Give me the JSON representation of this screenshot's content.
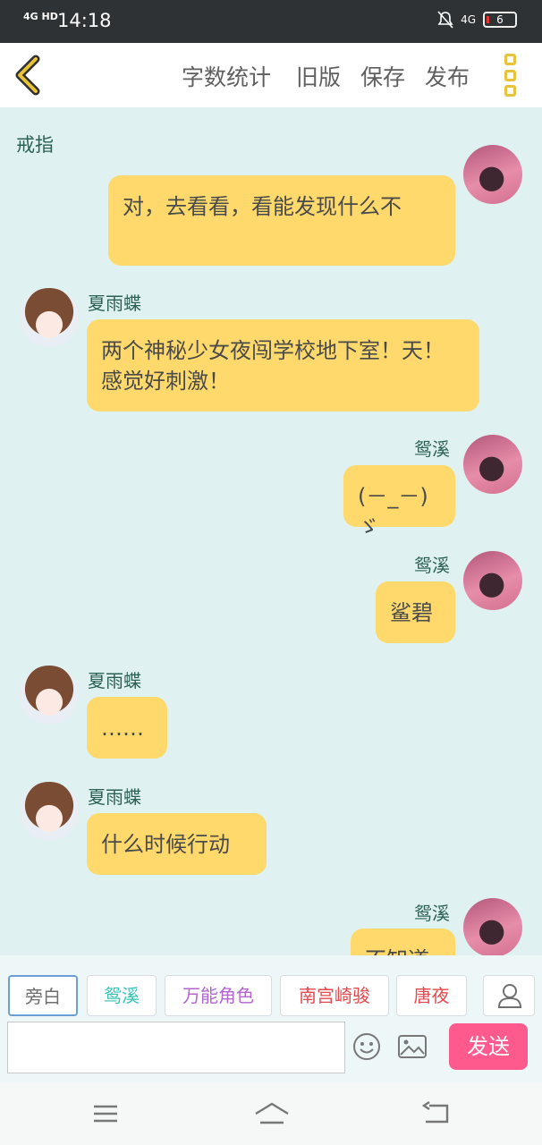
{
  "status_bar": {
    "signal": "4G HD",
    "time": "14:18",
    "network": "4G",
    "battery": "6"
  },
  "header": {
    "buttons": [
      "字数统计",
      "旧版",
      "保存",
      "发布"
    ]
  },
  "chat": {
    "top_name": "戒指",
    "messages": [
      {
        "sender": "",
        "side": "right",
        "text": "对，去看看，看能发现什么不"
      },
      {
        "sender": "夏雨蝶",
        "side": "left",
        "text": "两个神秘少女夜闯学校地下室！天！感觉好刺激！"
      },
      {
        "sender": "鸳溪",
        "side": "right",
        "text": "(－_－) ゞ"
      },
      {
        "sender": "鸳溪",
        "side": "right",
        "text": "鲨碧"
      },
      {
        "sender": "夏雨蝶",
        "side": "left",
        "text": "……"
      },
      {
        "sender": "夏雨蝶",
        "side": "left",
        "text": "什么时候行动"
      },
      {
        "sender": "鸳溪",
        "side": "right",
        "text": "不知道"
      }
    ]
  },
  "role_chips": [
    {
      "label": "旁白",
      "color": "#6e6e6e"
    },
    {
      "label": "鸳溪",
      "color": "#35c2b6"
    },
    {
      "label": "万能角色",
      "color": "#b365d1"
    },
    {
      "label": "南宫崎骏",
      "color": "#e5484d"
    },
    {
      "label": "唐夜",
      "color": "#e5484d"
    }
  ],
  "input": {
    "placeholder": "",
    "send_label": "发送"
  }
}
